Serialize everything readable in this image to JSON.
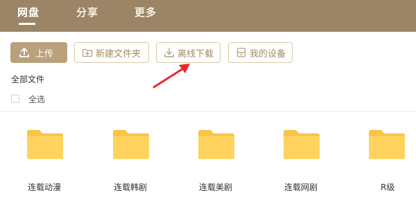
{
  "nav": {
    "tabs": [
      {
        "label": "网盘",
        "active": true
      },
      {
        "label": "分享",
        "active": false
      },
      {
        "label": "更多",
        "active": false
      }
    ]
  },
  "toolbar": {
    "upload_label": "上传",
    "new_folder_label": "新建文件夹",
    "offline_download_label": "离线下载",
    "my_devices_label": "我的设备"
  },
  "breadcrumb": "全部文件",
  "select_all_label": "全选",
  "folders": [
    {
      "name": "连载动漫"
    },
    {
      "name": "连载韩剧"
    },
    {
      "name": "连载美剧"
    },
    {
      "name": "连载网剧"
    },
    {
      "name": "R级"
    }
  ],
  "colors": {
    "nav_bg": "#9b8566",
    "primary_button": "#b9a17c",
    "outline_text": "#a58a5c",
    "folder_yellow": "#ffd35e",
    "annotation_arrow": "#e8262a"
  }
}
